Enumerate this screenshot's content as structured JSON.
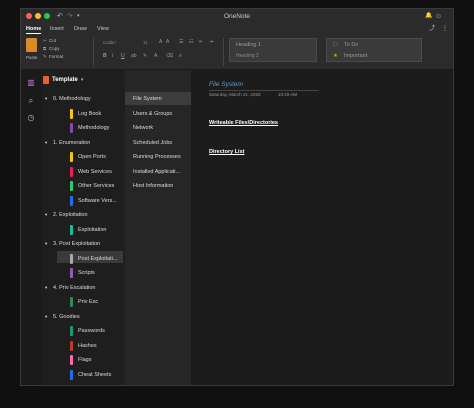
{
  "app": {
    "title": "OneNote"
  },
  "tabs": [
    "Home",
    "Insert",
    "Draw",
    "View"
  ],
  "ribbon": {
    "paste": "Paste",
    "cut": "Cut",
    "copy": "Copy",
    "format": "Format",
    "font": "Calibri",
    "size": "11",
    "style1": "Heading 1",
    "style2": "Heading 2",
    "tag1": "To Do",
    "tag2": "Important"
  },
  "notebook": {
    "title": "Template"
  },
  "sections": [
    {
      "label": "0. Methodology",
      "group": true
    },
    {
      "label": "Log Book",
      "color": "#f5c518"
    },
    {
      "label": "Methodology",
      "color": "#8e44ad"
    },
    {
      "label": "1. Enumeration",
      "group": true
    },
    {
      "label": "Open Ports",
      "color": "#f1c40f"
    },
    {
      "label": "Web Services",
      "color": "#e91e63"
    },
    {
      "label": "Other Services",
      "color": "#2ecc71"
    },
    {
      "label": "Software Vers...",
      "color": "#1e6ee8"
    },
    {
      "label": "2. Exploitation",
      "group": true
    },
    {
      "label": "Exploitation",
      "color": "#1abc9c"
    },
    {
      "label": "3. Post Exploitation",
      "group": true
    },
    {
      "label": "Post Exploitati...",
      "color": "#aaaaaa"
    },
    {
      "label": "Scripts",
      "color": "#9b59b6"
    },
    {
      "label": "4. Priv Escalation",
      "group": true
    },
    {
      "label": "Priv Esc",
      "color": "#2e8b57"
    },
    {
      "label": "5. Goodies",
      "group": true
    },
    {
      "label": "Passwords",
      "color": "#1a9b6b"
    },
    {
      "label": "Hashes",
      "color": "#c0392b"
    },
    {
      "label": "Flags",
      "color": "#ff69b4"
    },
    {
      "label": "Cheat Sheets",
      "color": "#1e6ee8"
    }
  ],
  "pages": [
    "File System",
    "Users & Groups",
    "Network",
    "Scheduled Jobs",
    "Running Processes",
    "Installed Applicati...",
    "Host Information"
  ],
  "note": {
    "title": "File System",
    "date": "Saturday, March 21, 2020",
    "time": "10:29 AM",
    "h1": "Writeable Files\\Directories",
    "h2": "Directory List"
  }
}
